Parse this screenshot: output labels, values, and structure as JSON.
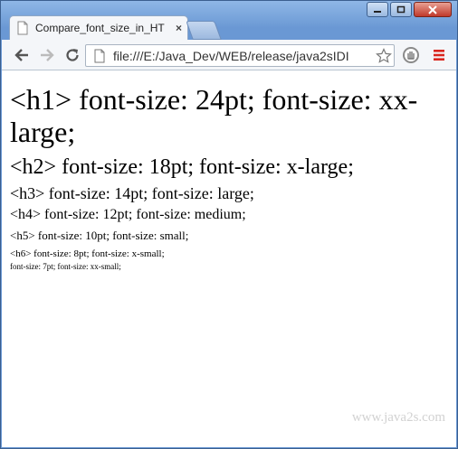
{
  "tab": {
    "title": "Compare_font_size_in_HT",
    "close_glyph": "×"
  },
  "address_bar": {
    "url": "file:///E:/Java_Dev/WEB/release/java2sIDI"
  },
  "content": {
    "lines": [
      "<h1> font-size: 24pt; font-size: xx-large;",
      "<h2> font-size: 18pt; font-size: x-large;",
      "<h3> font-size: 14pt; font-size: large;",
      "<h4> font-size: 12pt; font-size: medium;",
      "<h5> font-size: 10pt; font-size: small;",
      "<h6> font-size: 8pt; font-size: x-small;",
      "font-size: 7pt; font-size: xx-small;"
    ],
    "watermark": "www.java2s.com"
  },
  "icons": {
    "tab_favicon": "page-icon",
    "back": "arrow-left-icon",
    "forward": "arrow-right-icon",
    "reload": "reload-icon",
    "page": "page-icon",
    "bookmark": "star-icon",
    "extension": "adblock-icon",
    "menu": "hamburger-menu-icon"
  },
  "colors": {
    "menu_icon": "#d9251d",
    "title_bar": "#6a98d4"
  }
}
